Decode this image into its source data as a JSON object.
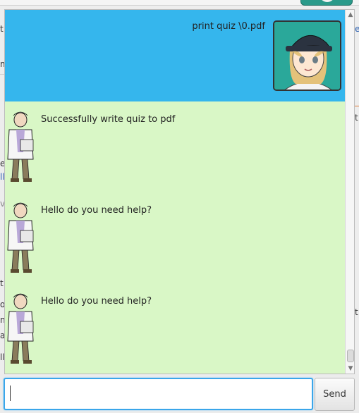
{
  "background": {
    "left_fragments": [
      "t",
      "m",
      "e",
      "ll",
      "v",
      "t",
      "o",
      "n",
      "a)",
      "ll"
    ],
    "right_fragments": [
      "e",
      "t",
      "t"
    ]
  },
  "chat": {
    "messages": [
      {
        "sender": "user",
        "text": "print quiz \\0.pdf",
        "avatar": "user-avatar"
      },
      {
        "sender": "bot",
        "text": "Successfully write quiz to pdf",
        "avatar": "professor-avatar"
      },
      {
        "sender": "bot",
        "text": "Hello do you need help?",
        "avatar": "professor-avatar"
      },
      {
        "sender": "bot",
        "text": "Hello do you need help?",
        "avatar": "professor-avatar"
      }
    ],
    "colors": {
      "user_bubble": "#35b6ed",
      "bot_bubble": "#d9f7c6",
      "input_border": "#3aa6ea"
    }
  },
  "input": {
    "value": "",
    "placeholder": ""
  },
  "send_button": {
    "label": "Send"
  },
  "icons": {
    "scroll_up": "scroll-up-arrow-icon",
    "scroll_down": "scroll-down-arrow-icon"
  }
}
